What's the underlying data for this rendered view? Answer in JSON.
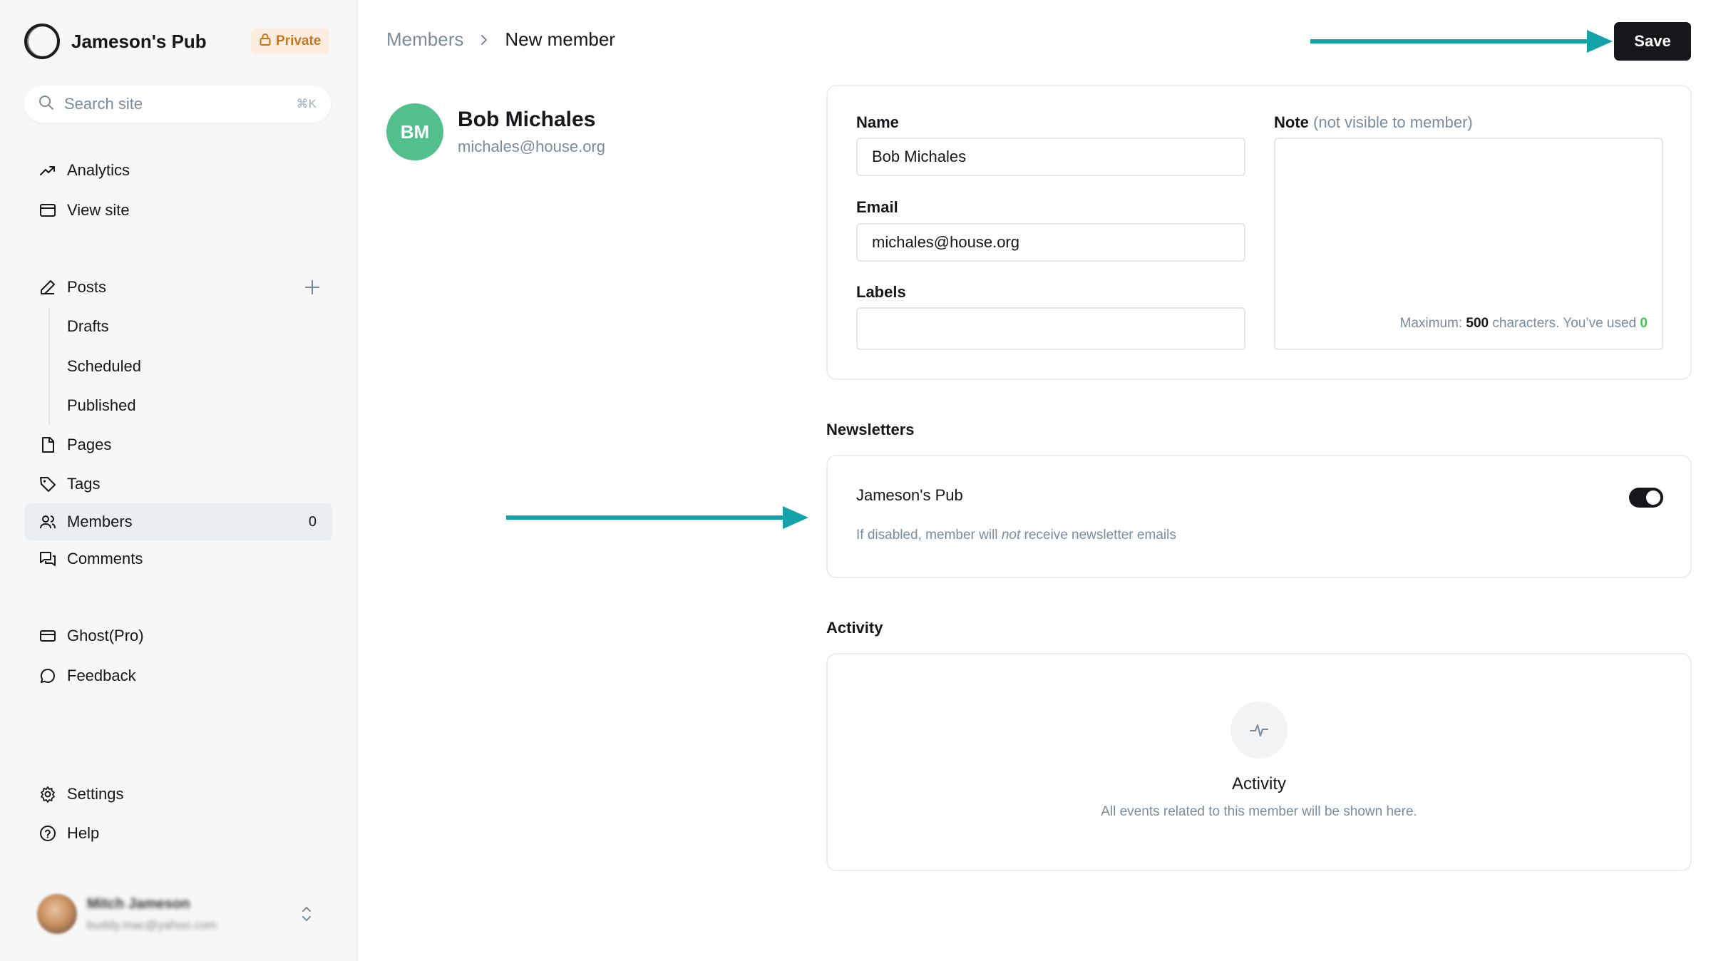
{
  "sidebar": {
    "site_name": "Jameson's Pub",
    "private_badge": "Private",
    "search": {
      "placeholder": "Search site",
      "shortcut": "⌘K"
    },
    "items": {
      "analytics": "Analytics",
      "view_site": "View site",
      "posts": "Posts",
      "drafts": "Drafts",
      "scheduled": "Scheduled",
      "published": "Published",
      "pages": "Pages",
      "tags": "Tags",
      "members": "Members",
      "members_count": "0",
      "comments": "Comments",
      "ghost_pro": "Ghost(Pro)",
      "feedback": "Feedback",
      "settings": "Settings",
      "help": "Help"
    },
    "user": {
      "name": "Mitch Jameson",
      "email": "buddy.mac@yahoo.com"
    }
  },
  "header": {
    "breadcrumb_parent": "Members",
    "breadcrumb_current": "New member",
    "save_label": "Save"
  },
  "member": {
    "initials": "BM",
    "name": "Bob Michales",
    "email": "michales@house.org"
  },
  "form": {
    "name_label": "Name",
    "name_value": "Bob Michales",
    "email_label": "Email",
    "email_value": "michales@house.org",
    "labels_label": "Labels",
    "labels_value": "",
    "note_label": "Note",
    "note_label_muted": "(not visible to member)",
    "note_hint_prefix": "Maximum:",
    "note_max": "500",
    "note_hint_middle": "characters. You’ve used",
    "note_used": "0"
  },
  "newsletters": {
    "title": "Newsletters",
    "item_name": "Jameson's Pub",
    "hint_before": "If disabled, member will",
    "hint_emph": "not",
    "hint_after": "receive newsletter emails",
    "enabled": true
  },
  "activity": {
    "section_title": "Activity",
    "empty_title": "Activity",
    "empty_desc": "All events related to this member will be shown here."
  },
  "colors": {
    "accent_arrow": "#14a3a8",
    "avatar_green": "#52bf8c",
    "private_badge_text": "#c4771f",
    "note_used_green": "#30cf43"
  }
}
